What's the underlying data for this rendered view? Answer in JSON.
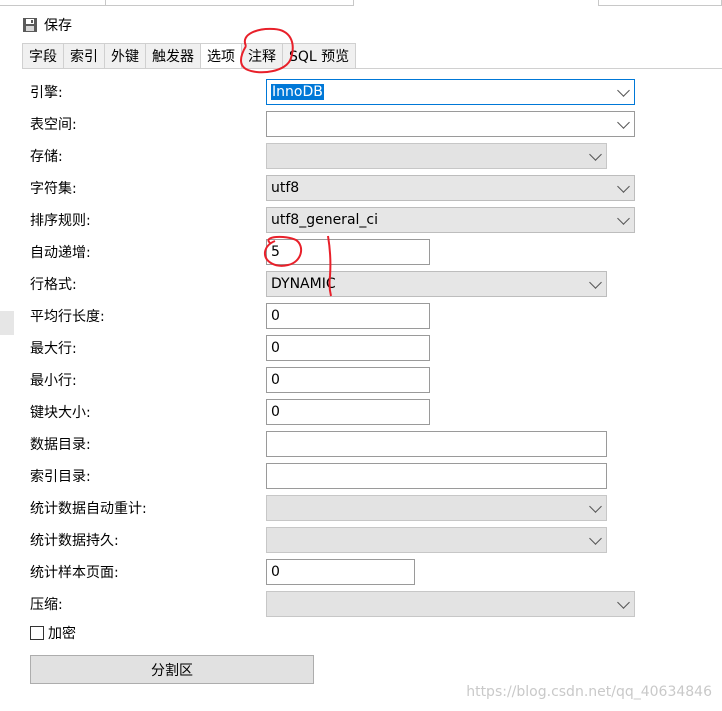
{
  "toolbar": {
    "save_label": "保存"
  },
  "tabs": [
    {
      "label": "字段"
    },
    {
      "label": "索引"
    },
    {
      "label": "外键"
    },
    {
      "label": "触发器"
    },
    {
      "label": "选项"
    },
    {
      "label": "注释"
    },
    {
      "label": "SQL 预览"
    }
  ],
  "active_tab": "选项",
  "fields": {
    "engine": {
      "label": "引擎:",
      "value": "InnoDB"
    },
    "tablespace": {
      "label": "表空间:",
      "value": ""
    },
    "storage": {
      "label": "存储:",
      "value": ""
    },
    "charset": {
      "label": "字符集:",
      "value": "utf8"
    },
    "collation": {
      "label": "排序规则:",
      "value": "utf8_general_ci"
    },
    "auto_increment": {
      "label": "自动递增:",
      "value": "5"
    },
    "row_format": {
      "label": "行格式:",
      "value": "DYNAMIC"
    },
    "avg_row_length": {
      "label": "平均行长度:",
      "value": "0"
    },
    "max_rows": {
      "label": "最大行:",
      "value": "0"
    },
    "min_rows": {
      "label": "最小行:",
      "value": "0"
    },
    "key_block_size": {
      "label": "键块大小:",
      "value": "0"
    },
    "data_directory": {
      "label": "数据目录:",
      "value": ""
    },
    "index_directory": {
      "label": "索引目录:",
      "value": ""
    },
    "stats_auto_recalc": {
      "label": "统计数据自动重计:",
      "value": ""
    },
    "stats_persistent": {
      "label": "统计数据持久:",
      "value": ""
    },
    "stats_sample_pages": {
      "label": "统计样本页面:",
      "value": "0"
    },
    "compression": {
      "label": "压缩:",
      "value": ""
    }
  },
  "encrypt": {
    "label": "加密",
    "checked": false
  },
  "partition_button": "分割区",
  "watermark": "https://blog.csdn.net/qq_40634846",
  "colors": {
    "accent": "#0078d7",
    "annotation": "#e8202a"
  }
}
